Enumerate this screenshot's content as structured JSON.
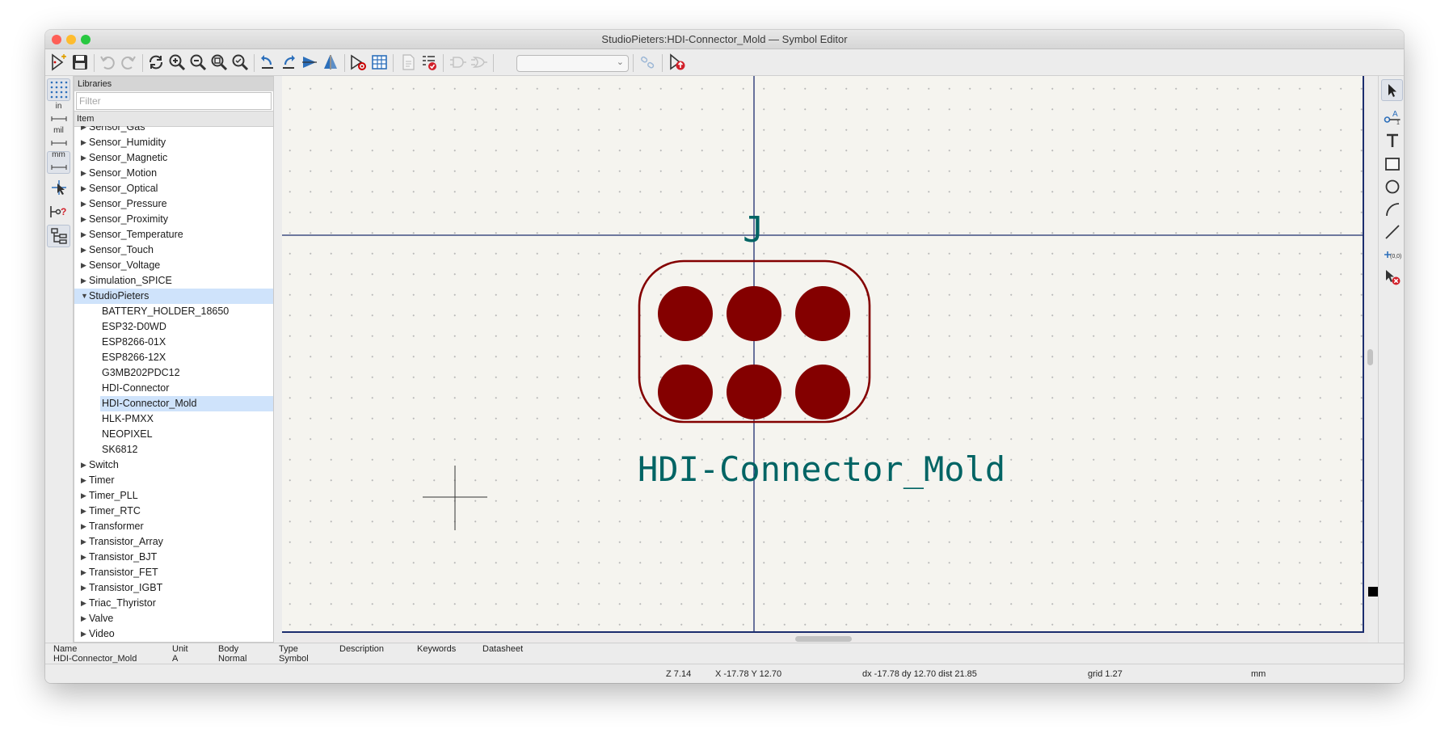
{
  "window": {
    "title": "StudioPieters:HDI-Connector_Mold — Symbol Editor",
    "traffic_colors": [
      "#fe5f57",
      "#febc2e",
      "#28c840"
    ]
  },
  "toolbar": {
    "icons": [
      "new-symbol-icon",
      "save-icon",
      "undo-icon",
      "redo-icon",
      "refresh-icon",
      "zoom-in-icon",
      "zoom-out-icon",
      "zoom-fit-icon",
      "zoom-selection-icon",
      "rotate-ccw-icon",
      "rotate-cw-icon",
      "mirror-horizontal-icon",
      "mirror-vertical-icon",
      "symbol-properties-icon",
      "pin-table-icon",
      "datasheet-icon",
      "check-symbol-icon",
      "unit-deMorgan-icon",
      "alternate-body-icon",
      "unit-selector",
      "link-icon",
      "export-symbol-icon"
    ]
  },
  "left_toolbar": {
    "labels": {
      "in": "in",
      "mil": "mil",
      "mm": "mm"
    }
  },
  "libraries": {
    "header": "Libraries",
    "filter_placeholder": "Filter",
    "column_header": "Item",
    "items": [
      {
        "label": "Sensor_Gas",
        "level": 0,
        "expanded": false
      },
      {
        "label": "Sensor_Humidity",
        "level": 0,
        "expanded": false
      },
      {
        "label": "Sensor_Magnetic",
        "level": 0,
        "expanded": false
      },
      {
        "label": "Sensor_Motion",
        "level": 0,
        "expanded": false
      },
      {
        "label": "Sensor_Optical",
        "level": 0,
        "expanded": false
      },
      {
        "label": "Sensor_Pressure",
        "level": 0,
        "expanded": false
      },
      {
        "label": "Sensor_Proximity",
        "level": 0,
        "expanded": false
      },
      {
        "label": "Sensor_Temperature",
        "level": 0,
        "expanded": false
      },
      {
        "label": "Sensor_Touch",
        "level": 0,
        "expanded": false
      },
      {
        "label": "Sensor_Voltage",
        "level": 0,
        "expanded": false
      },
      {
        "label": "Simulation_SPICE",
        "level": 0,
        "expanded": false
      },
      {
        "label": "StudioPieters",
        "level": 0,
        "expanded": true,
        "selected": true
      },
      {
        "label": "BATTERY_HOLDER_18650",
        "level": 1
      },
      {
        "label": "ESP32-D0WD",
        "level": 1
      },
      {
        "label": "ESP8266-01X",
        "level": 1
      },
      {
        "label": "ESP8266-12X",
        "level": 1
      },
      {
        "label": "G3MB202PDC12",
        "level": 1
      },
      {
        "label": "HDI-Connector",
        "level": 1
      },
      {
        "label": "HDI-Connector_Mold",
        "level": 1,
        "selected": true
      },
      {
        "label": "HLK-PMXX",
        "level": 1
      },
      {
        "label": "NEOPIXEL",
        "level": 1
      },
      {
        "label": "SK6812",
        "level": 1
      },
      {
        "label": "Switch",
        "level": 0,
        "expanded": false
      },
      {
        "label": "Timer",
        "level": 0,
        "expanded": false
      },
      {
        "label": "Timer_PLL",
        "level": 0,
        "expanded": false
      },
      {
        "label": "Timer_RTC",
        "level": 0,
        "expanded": false
      },
      {
        "label": "Transformer",
        "level": 0,
        "expanded": false
      },
      {
        "label": "Transistor_Array",
        "level": 0,
        "expanded": false
      },
      {
        "label": "Transistor_BJT",
        "level": 0,
        "expanded": false
      },
      {
        "label": "Transistor_FET",
        "level": 0,
        "expanded": false
      },
      {
        "label": "Transistor_IGBT",
        "level": 0,
        "expanded": false
      },
      {
        "label": "Triac_Thyristor",
        "level": 0,
        "expanded": false
      },
      {
        "label": "Valve",
        "level": 0,
        "expanded": false
      },
      {
        "label": "Video",
        "level": 0,
        "expanded": false
      }
    ]
  },
  "canvas": {
    "reference": "J",
    "value": "HDI-Connector_Mold",
    "body_color": "#840000",
    "text_color": "#006464",
    "axis_color": "#1c2d6e"
  },
  "right_toolbar": {
    "icons": [
      "select-arrow-icon",
      "add-pin-icon",
      "add-text-icon",
      "add-rectangle-icon",
      "add-circle-icon",
      "add-arc-icon",
      "add-line-icon",
      "set-anchor-icon",
      "delete-icon"
    ]
  },
  "properties": {
    "name_label": "Name",
    "name_value": "HDI-Connector_Mold",
    "unit_label": "Unit",
    "unit_value": "A",
    "body_label": "Body",
    "body_value": "Normal",
    "type_label": "Type",
    "type_value": "Symbol",
    "description_label": "Description",
    "keywords_label": "Keywords",
    "datasheet_label": "Datasheet"
  },
  "status": {
    "zoom": "Z 7.14",
    "xy": "X -17.78  Y 12.70",
    "delta": "dx -17.78  dy 12.70  dist 21.85",
    "grid": "grid 1.27",
    "units": "mm"
  }
}
